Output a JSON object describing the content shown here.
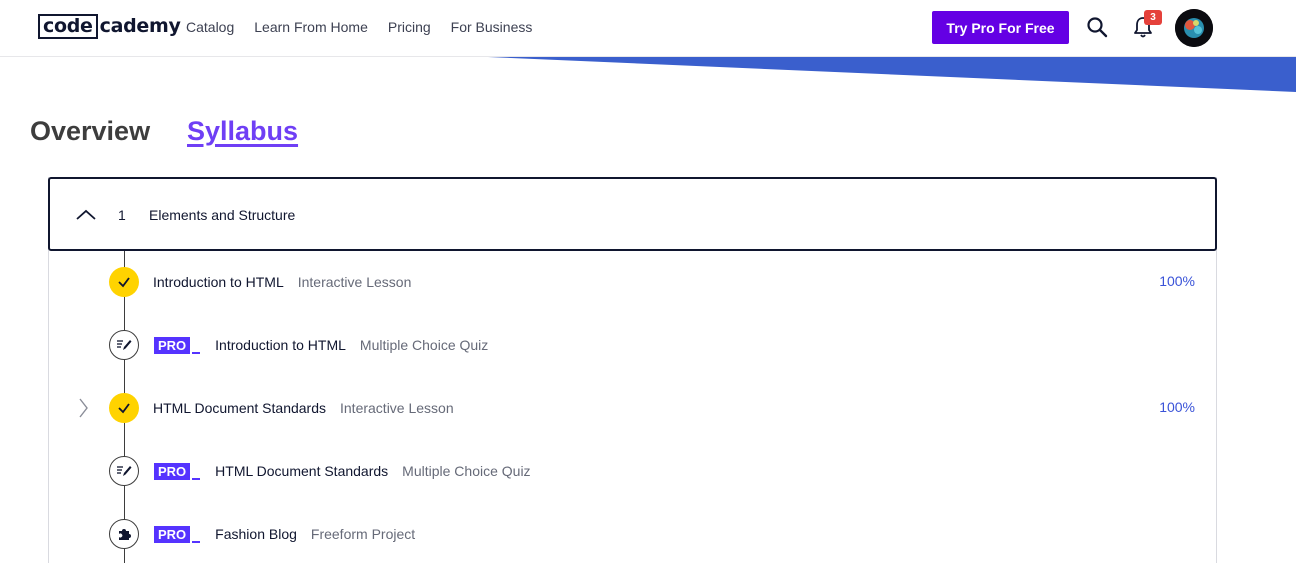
{
  "header": {
    "logo_part1": "code",
    "logo_part2": "cademy",
    "nav": [
      "Catalog",
      "Learn From Home",
      "Pricing",
      "For Business"
    ],
    "cta_label": "Try Pro For Free",
    "notification_count": "3"
  },
  "colors": {
    "accent": "#6400e4",
    "pro": "#5533ff",
    "check": "#ffd300",
    "progress_text": "#3a53d8",
    "wedge": "#3a5fcd"
  },
  "tabs": {
    "overview": "Overview",
    "syllabus": "Syllabus"
  },
  "module": {
    "number": "1",
    "title": "Elements and Structure",
    "items": [
      {
        "title": "Introduction to HTML",
        "type": "Interactive Lesson",
        "pro": false,
        "status": "complete",
        "progress": "100%",
        "icon": "check-icon"
      },
      {
        "title": "Introduction to HTML",
        "type": "Multiple Choice Quiz",
        "pro": true,
        "pro_label": "PRO",
        "status": "incomplete",
        "icon": "quiz-icon"
      },
      {
        "title": "HTML Document Standards",
        "type": "Interactive Lesson",
        "pro": false,
        "status": "complete",
        "progress": "100%",
        "icon": "check-icon"
      },
      {
        "title": "HTML Document Standards",
        "type": "Multiple Choice Quiz",
        "pro": true,
        "pro_label": "PRO",
        "status": "incomplete",
        "icon": "quiz-icon"
      },
      {
        "title": "Fashion Blog",
        "type": "Freeform Project",
        "pro": true,
        "pro_label": "PRO",
        "status": "incomplete",
        "icon": "puzzle-icon"
      }
    ]
  }
}
